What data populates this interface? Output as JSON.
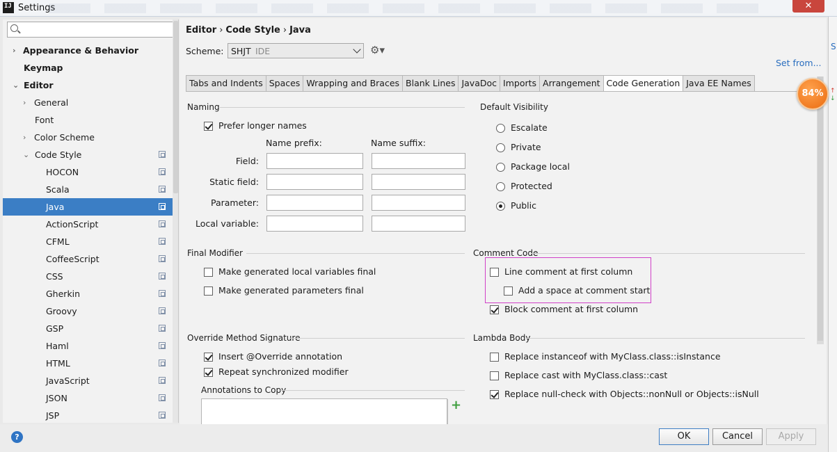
{
  "window": {
    "app_icon": "IJ",
    "title": "Settings",
    "close_glyph": "✕"
  },
  "search": {
    "placeholder": "",
    "value": ""
  },
  "sidebar": {
    "items": [
      {
        "label": "Appearance & Behavior",
        "arrow": "›",
        "bold": true
      },
      {
        "label": "Keymap",
        "bold": true
      },
      {
        "label": "Editor",
        "arrow": "⌄",
        "bold": true
      },
      {
        "label": "General",
        "arrow": "›"
      },
      {
        "label": "Font"
      },
      {
        "label": "Color Scheme",
        "arrow": "›"
      },
      {
        "label": "Code Style",
        "arrow": "⌄",
        "copy": true
      },
      {
        "label": "HOCON",
        "copy": true
      },
      {
        "label": "Scala",
        "copy": true
      },
      {
        "label": "Java",
        "copy": true,
        "selected": true
      },
      {
        "label": "ActionScript",
        "copy": true
      },
      {
        "label": "CFML",
        "copy": true
      },
      {
        "label": "CoffeeScript",
        "copy": true
      },
      {
        "label": "CSS",
        "copy": true
      },
      {
        "label": "Gherkin",
        "copy": true
      },
      {
        "label": "Groovy",
        "copy": true
      },
      {
        "label": "GSP",
        "copy": true
      },
      {
        "label": "Haml",
        "copy": true
      },
      {
        "label": "HTML",
        "copy": true
      },
      {
        "label": "JavaScript",
        "copy": true
      },
      {
        "label": "JSON",
        "copy": true
      },
      {
        "label": "JSP",
        "copy": true
      }
    ]
  },
  "breadcrumb": {
    "part1": "Editor",
    "part2": "Code Style",
    "part3": "Java",
    "sep": "›"
  },
  "scheme": {
    "label": "Scheme:",
    "name": "SHJT",
    "kind": "IDE"
  },
  "gear": {
    "glyph": "⚙▾"
  },
  "set_from": "Set from...",
  "tabs": [
    {
      "label": "Tabs and Indents"
    },
    {
      "label": "Spaces"
    },
    {
      "label": "Wrapping and Braces"
    },
    {
      "label": "Blank Lines"
    },
    {
      "label": "JavaDoc"
    },
    {
      "label": "Imports"
    },
    {
      "label": "Arrangement"
    },
    {
      "label": "Code Generation",
      "active": true
    },
    {
      "label": "Java EE Names"
    }
  ],
  "naming": {
    "title": "Naming",
    "prefer_longer": {
      "label": "Prefer longer names",
      "checked": true
    },
    "name_prefix": "Name prefix:",
    "name_suffix": "Name suffix:",
    "rows": [
      {
        "label": "Field:",
        "prefix": "",
        "suffix": ""
      },
      {
        "label": "Static field:",
        "prefix": "",
        "suffix": ""
      },
      {
        "label": "Parameter:",
        "prefix": "",
        "suffix": ""
      },
      {
        "label": "Local variable:",
        "prefix": "",
        "suffix": ""
      }
    ]
  },
  "default_visibility": {
    "title": "Default Visibility",
    "options": [
      {
        "label": "Escalate",
        "selected": false
      },
      {
        "label": "Private",
        "selected": false
      },
      {
        "label": "Package local",
        "selected": false
      },
      {
        "label": "Protected",
        "selected": false
      },
      {
        "label": "Public",
        "selected": true
      }
    ]
  },
  "final_modifier": {
    "title": "Final Modifier",
    "local_vars": {
      "label": "Make generated local variables final",
      "checked": false
    },
    "params": {
      "label": "Make generated parameters final",
      "checked": false
    }
  },
  "comment_code": {
    "title": "Comment Code",
    "line_first_col": {
      "label": "Line comment at first column",
      "checked": false
    },
    "add_space": {
      "label": "Add a space at comment start",
      "checked": false
    },
    "block_first_col": {
      "label": "Block comment at first column",
      "checked": true
    }
  },
  "override": {
    "title": "Override Method Signature",
    "insert_override": {
      "label": "Insert @Override annotation",
      "checked": true
    },
    "repeat_sync": {
      "label": "Repeat synchronized modifier",
      "checked": true
    },
    "annotations_title": "Annotations to Copy"
  },
  "lambda": {
    "title": "Lambda Body",
    "instanceof": {
      "label": "Replace instanceof with MyClass.class::isInstance",
      "checked": false
    },
    "cast": {
      "label": "Replace cast with MyClass.class::cast",
      "checked": false
    },
    "nullcheck": {
      "label": "Replace null-check with Objects::nonNull or Objects::isNull",
      "checked": true
    }
  },
  "add_glyph": "+",
  "badge": {
    "text": "84%",
    "up": "↑",
    "down": "↓"
  },
  "right_edge_letter": "S",
  "buttons": {
    "ok": "OK",
    "cancel": "Cancel",
    "apply": "Apply",
    "help": "?"
  },
  "colors": {
    "accent": "#3b7ec5",
    "link": "#2a6ebf",
    "highlight": "#d040c8",
    "badge": "#ea6b10"
  }
}
